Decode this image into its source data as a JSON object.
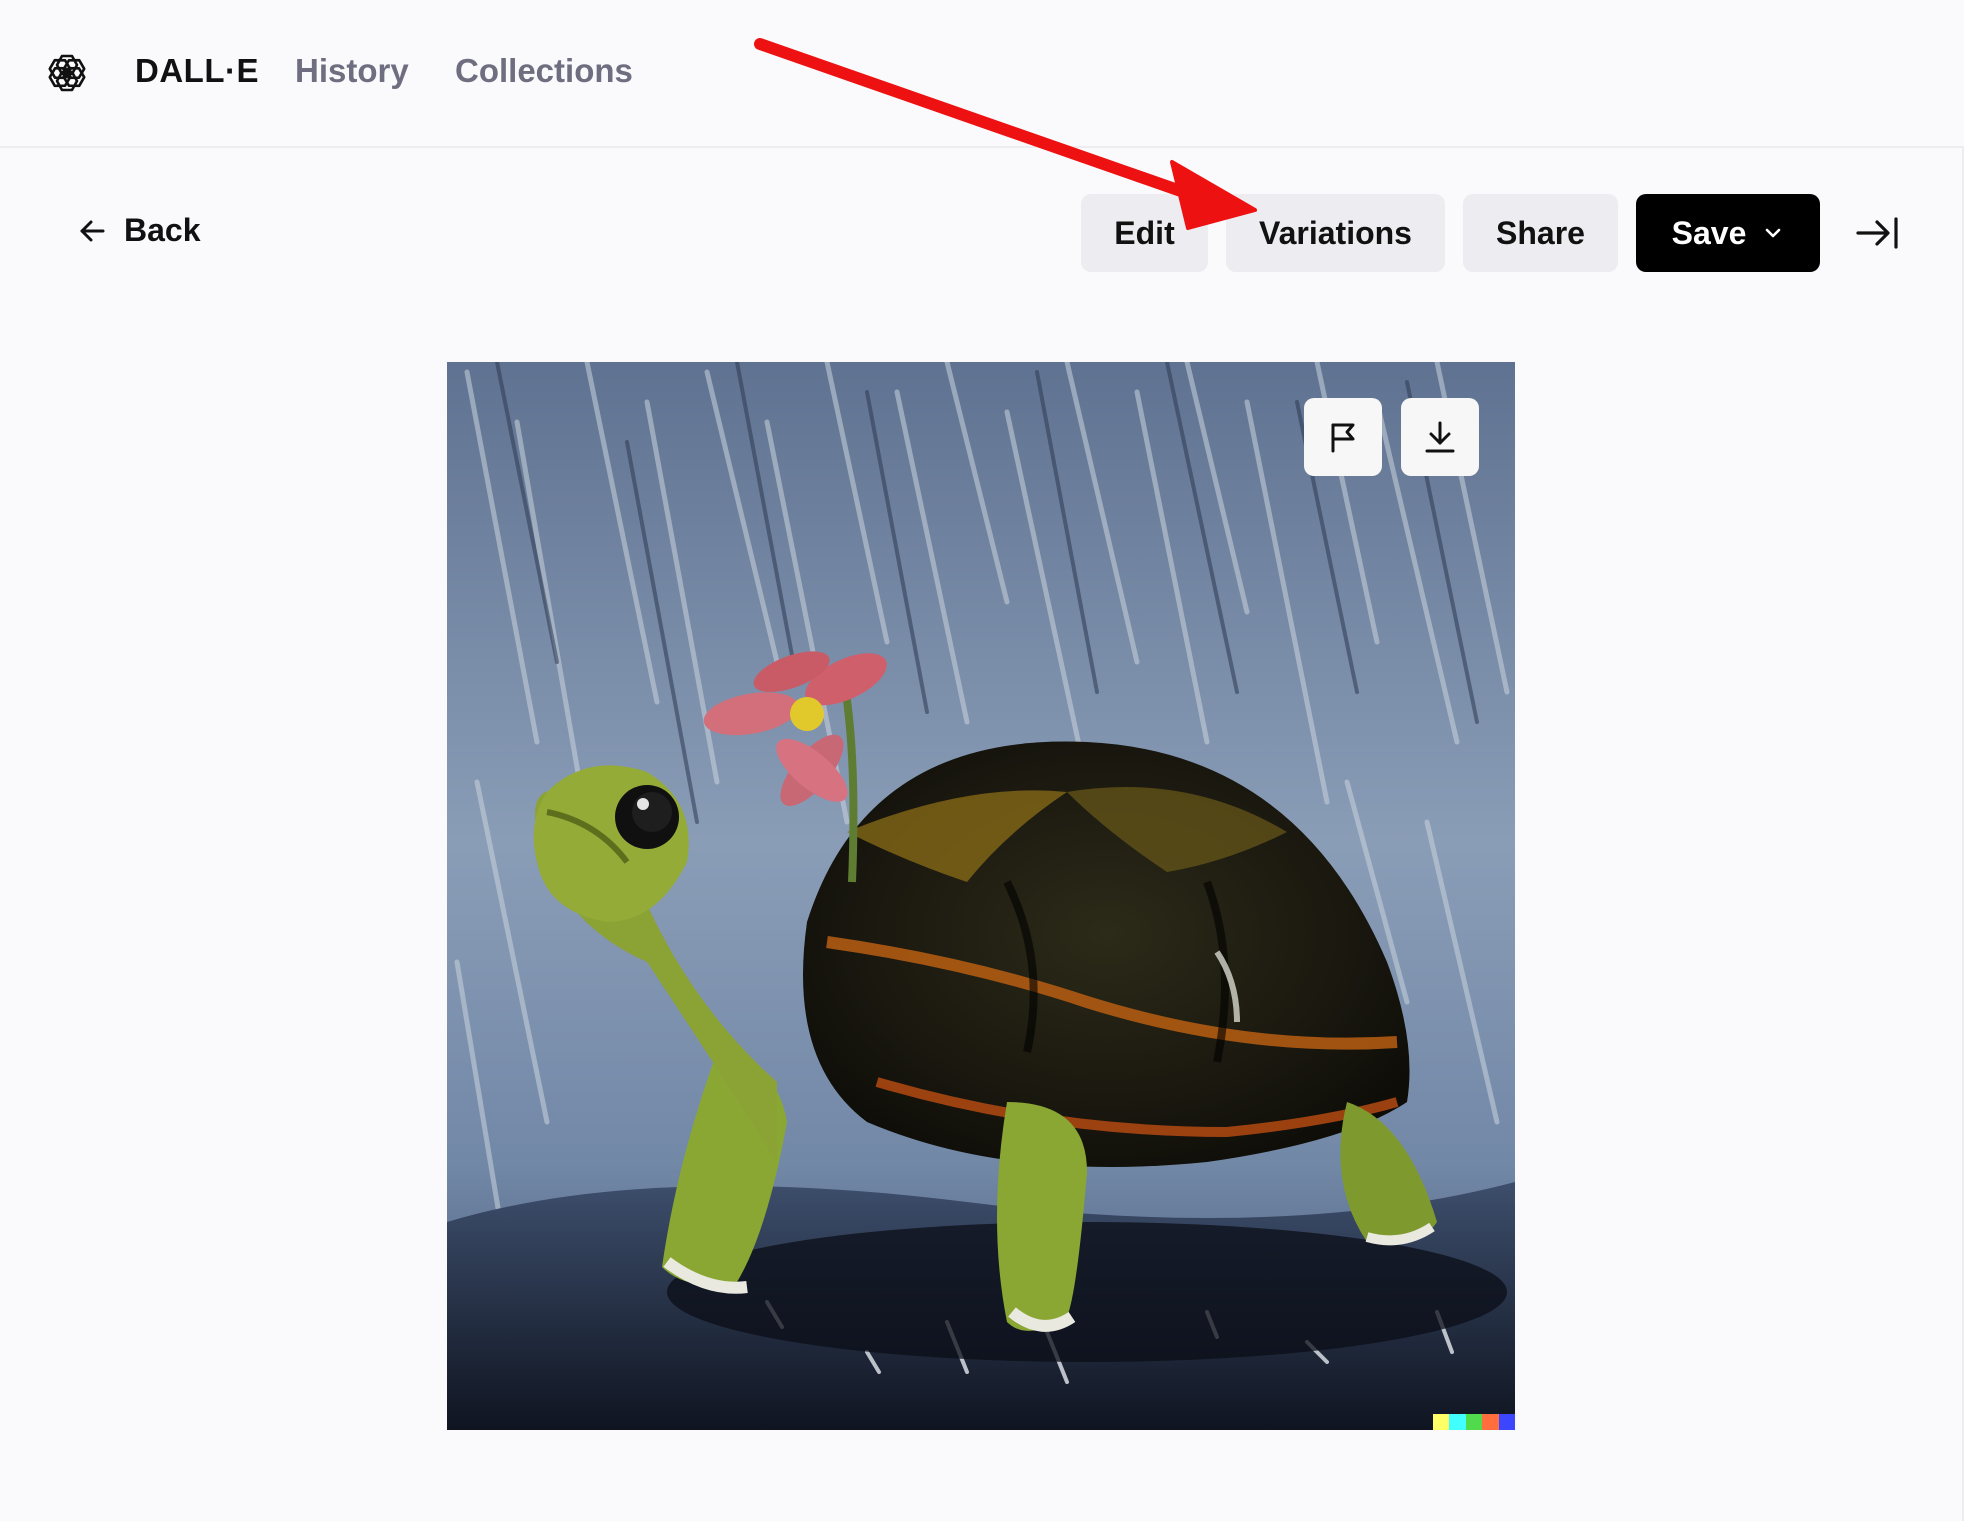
{
  "nav": {
    "brand": "DALL·E",
    "links": [
      "History",
      "Collections"
    ]
  },
  "toolbar": {
    "back_label": "Back",
    "edit_label": "Edit",
    "variations_label": "Variations",
    "share_label": "Share",
    "save_label": "Save"
  },
  "image": {
    "subject": "painting of a green turtle with a pink flower walking in the rain",
    "actions": [
      "flag-icon",
      "download-icon"
    ],
    "signature_colors": [
      "#ffff66",
      "#42ffff",
      "#51da4c",
      "#ff6e3c",
      "#3c46ff"
    ]
  },
  "annotation": {
    "arrow_color": "#ee1111"
  },
  "colors": {
    "page_bg": "#fafafc",
    "secondary_button_bg": "#ececf1",
    "primary_button_bg": "#000000",
    "nav_muted": "#6e6e80"
  }
}
